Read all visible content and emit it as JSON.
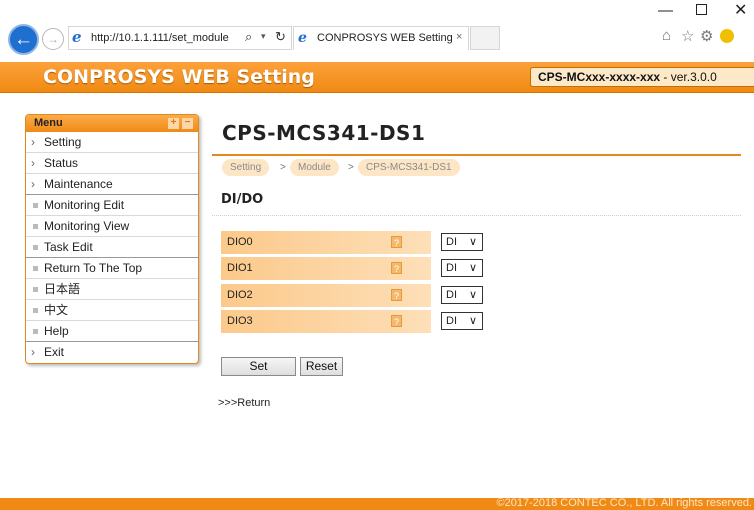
{
  "browser": {
    "url": "http://10.1.1.111/set_module",
    "tab_title": "CONPROSYS WEB Setting",
    "tab_close": "×",
    "minimize_glyph": "—",
    "close_glyph": "✕"
  },
  "header": {
    "title": "CONPROSYS WEB Setting",
    "model": "CPS-MCxxx-xxxx-xxx",
    "separator": " - ",
    "version": "ver.3.0.0"
  },
  "menu": {
    "title": "Menu",
    "expand_glyph": "+",
    "collapse_glyph": "−",
    "items": [
      {
        "label": "Setting",
        "kind": "chevron"
      },
      {
        "label": "Status",
        "kind": "chevron"
      },
      {
        "label": "Maintenance",
        "kind": "chevron"
      },
      {
        "label": "Monitoring Edit",
        "kind": "square"
      },
      {
        "label": "Monitoring View",
        "kind": "square"
      },
      {
        "label": "Task Edit",
        "kind": "square"
      },
      {
        "label": "Return To The Top",
        "kind": "square"
      },
      {
        "label": "日本語",
        "kind": "square"
      },
      {
        "label": "中文",
        "kind": "square"
      },
      {
        "label": "Help",
        "kind": "square"
      },
      {
        "label": "Exit",
        "kind": "chevron"
      }
    ]
  },
  "main": {
    "title": "CPS-MCS341-DS1",
    "breadcrumb": [
      "Setting",
      "Module",
      "CPS-MCS341-DS1"
    ],
    "breadcrumb_sep": ">",
    "section": "DI/DO",
    "rows": [
      {
        "label": "DIO0",
        "value": "DI"
      },
      {
        "label": "DIO1",
        "value": "DI"
      },
      {
        "label": "DIO2",
        "value": "DI"
      },
      {
        "label": "DIO3",
        "value": "DI"
      }
    ],
    "help_glyph": "?",
    "select_arrow": "∨",
    "set_label": "Set",
    "reset_label": "Reset",
    "return_link": ">>>Return"
  },
  "footer": {
    "copyright": "©2017-2018 CONTEC CO., LTD. All rights reserved."
  }
}
